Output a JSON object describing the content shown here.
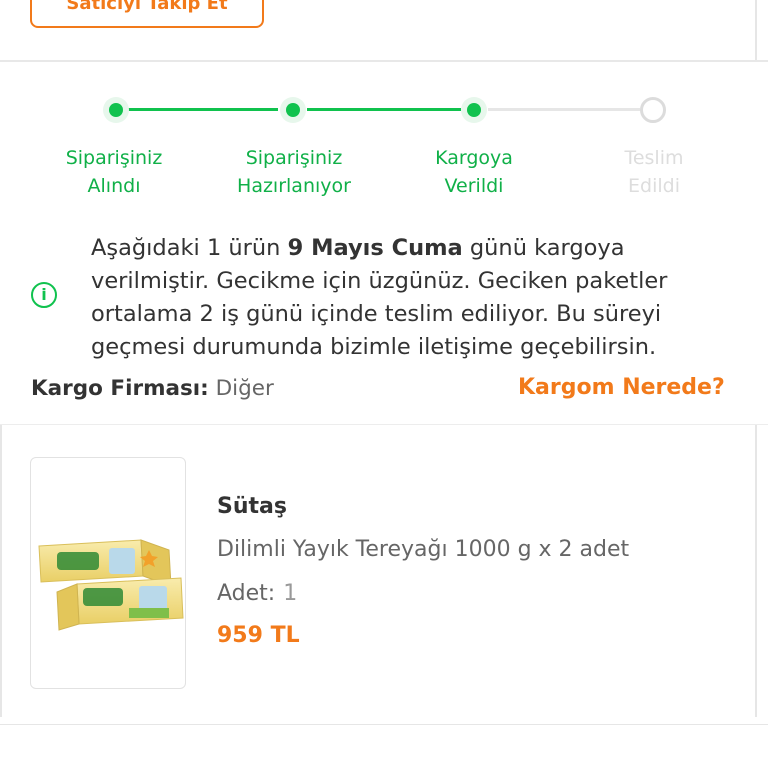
{
  "seller": {
    "follow_label": "Satıcıyı Takip Et"
  },
  "tracker": {
    "steps": [
      {
        "line1": "Siparişiniz",
        "line2": "Alındı",
        "status": "done"
      },
      {
        "line1": "Siparişiniz",
        "line2": "Hazırlanıyor",
        "status": "done"
      },
      {
        "line1": "Kargoya",
        "line2": "Verildi",
        "status": "done"
      },
      {
        "line1": "Teslim",
        "line2": "Edildi",
        "status": "pending"
      }
    ],
    "colors": {
      "done": "#10c24e",
      "pending": "#dcdcdc"
    }
  },
  "info": {
    "icon": "info-icon",
    "part1": "Aşağıdaki 1 ürün ",
    "date": "9 Mayıs Cuma",
    "part2": " günü kargoya verilmiştir. Gecikme için üzgünüz. Geciken paketler ortalama 2 iş günü içinde teslim ediliyor. Bu süreyi geçmesi durumunda bizimle iletişime geçebilirsin."
  },
  "shipping": {
    "company_label": "Kargo Firması:",
    "company_value": "Diğer",
    "where_link": "Kargom Nerede?"
  },
  "product": {
    "brand": "Sütaş",
    "name": "Dilimli Yayık Tereyağı 1000 g x 2 adet",
    "qty_label": "Adet:",
    "qty_value": "1",
    "price": "959 TL",
    "image_icon": "butter-product-image"
  },
  "accent": "#f27a1a"
}
